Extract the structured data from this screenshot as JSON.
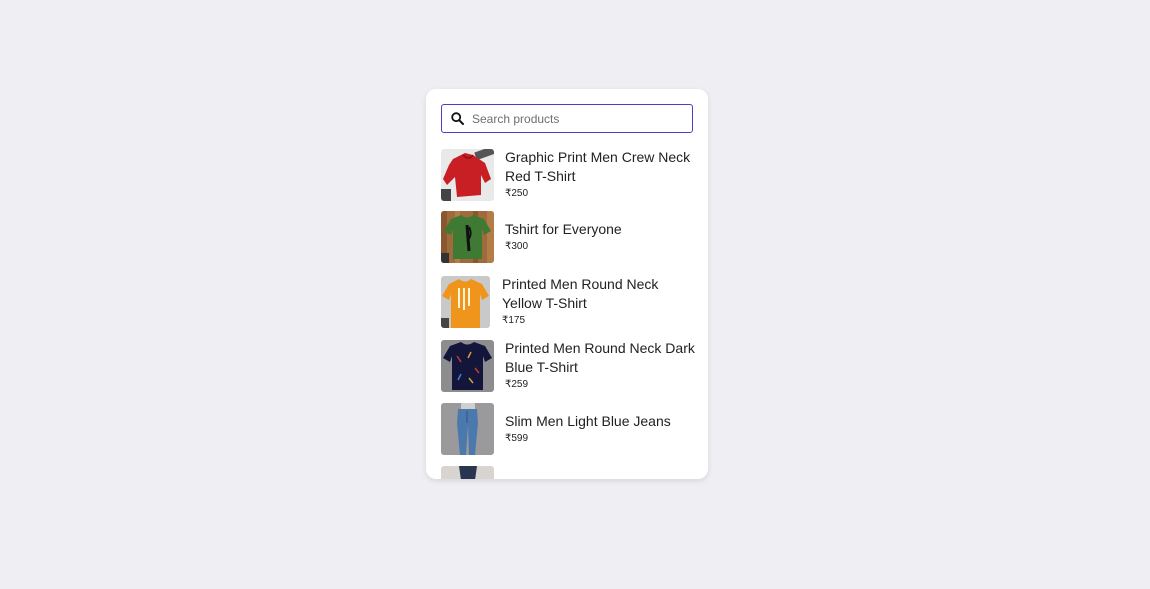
{
  "search": {
    "placeholder": "Search products"
  },
  "products": [
    {
      "name": "Graphic Print Men Crew Neck Red T-Shirt",
      "price": "₹250",
      "image_icon": "red-sweatshirt-image"
    },
    {
      "name": "Tshirt for Everyone",
      "price": "₹300",
      "image_icon": "green-tshirt-image"
    },
    {
      "name": "Printed Men Round Neck Yellow T-Shirt",
      "price": "₹175",
      "image_icon": "yellow-tshirt-image"
    },
    {
      "name": "Printed Men Round Neck Dark Blue T-Shirt",
      "price": "₹259",
      "image_icon": "dark-blue-tshirt-image"
    },
    {
      "name": "Slim Men Light Blue Jeans",
      "price": "₹599",
      "image_icon": "blue-jeans-image"
    }
  ],
  "colors": {
    "page_background": "#efeff3",
    "card_background": "#ffffff",
    "search_border": "#4b3fc4"
  }
}
